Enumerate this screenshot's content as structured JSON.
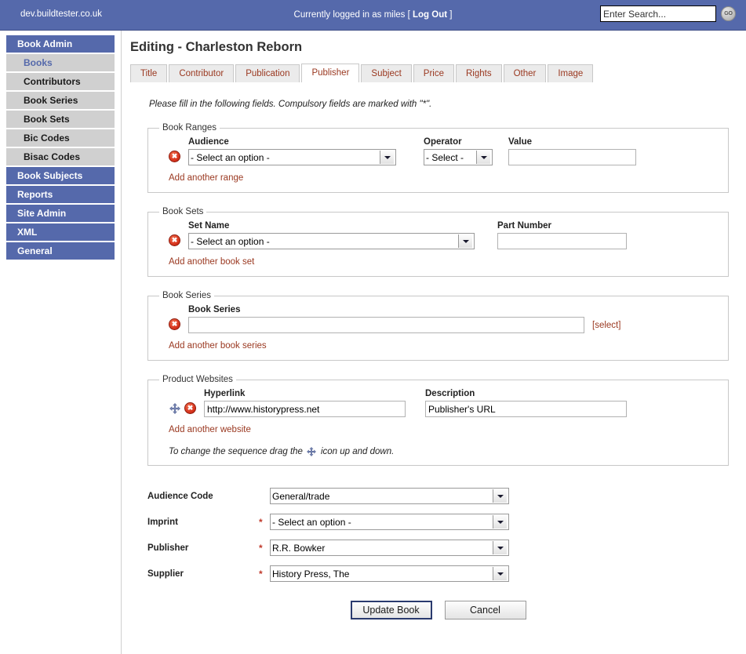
{
  "topbar": {
    "domain": "dev.buildtester.co.uk",
    "login_prefix": "Currently logged in as miles [ ",
    "logout_label": "Log Out",
    "login_suffix": " ]",
    "search_placeholder": "Enter Search...",
    "search_value": "",
    "go_label": "GO",
    "background_color": "#5569ab"
  },
  "sidebar": {
    "items": [
      {
        "label": "Book Admin",
        "type": "header",
        "active": false
      },
      {
        "label": "Books",
        "type": "sub",
        "active": true
      },
      {
        "label": "Contributors",
        "type": "sub",
        "active": false
      },
      {
        "label": "Book Series",
        "type": "sub",
        "active": false
      },
      {
        "label": "Book Sets",
        "type": "sub",
        "active": false
      },
      {
        "label": "Bic Codes",
        "type": "sub",
        "active": false
      },
      {
        "label": "Bisac Codes",
        "type": "sub",
        "active": false
      },
      {
        "label": "Book Subjects",
        "type": "header",
        "active": false
      },
      {
        "label": "Reports",
        "type": "header",
        "active": false
      },
      {
        "label": "Site Admin",
        "type": "header",
        "active": false
      },
      {
        "label": "XML",
        "type": "header",
        "active": false
      },
      {
        "label": "General",
        "type": "header",
        "active": false
      }
    ]
  },
  "main": {
    "page_title": "Editing - Charleston Reborn",
    "tabs": [
      {
        "label": "Title",
        "active": false
      },
      {
        "label": "Contributor",
        "active": false
      },
      {
        "label": "Publication",
        "active": false
      },
      {
        "label": "Publisher",
        "active": true
      },
      {
        "label": "Subject",
        "active": false
      },
      {
        "label": "Price",
        "active": false
      },
      {
        "label": "Rights",
        "active": false
      },
      {
        "label": "Other",
        "active": false
      },
      {
        "label": "Image",
        "active": false
      }
    ],
    "intro_note": "Please fill in the following fields. Compulsory fields are marked with \"*\".",
    "book_ranges": {
      "legend": "Book Ranges",
      "audience_label": "Audience",
      "audience_value": "- Select an option -",
      "operator_label": "Operator",
      "operator_value": "- Select -",
      "value_label": "Value",
      "value_value": "",
      "add_link": "Add another range"
    },
    "book_sets": {
      "legend": "Book Sets",
      "set_name_label": "Set Name",
      "set_name_value": "- Select an option -",
      "part_number_label": "Part Number",
      "part_number_value": "",
      "add_link": "Add another book set"
    },
    "book_series": {
      "legend": "Book Series",
      "field_label": "Book Series",
      "field_value": "",
      "select_link": "[select]",
      "add_link": "Add another book series"
    },
    "product_websites": {
      "legend": "Product Websites",
      "hyperlink_label": "Hyperlink",
      "hyperlink_value": "http://www.historypress.net",
      "description_label": "Description",
      "description_value": "Publisher's URL",
      "add_link": "Add another website",
      "hint_before": "To change the sequence drag the",
      "hint_after": "icon up and down."
    },
    "bottom_fields": [
      {
        "label": "Audience Code",
        "required": "",
        "value": "General/trade"
      },
      {
        "label": "Imprint",
        "required": "*",
        "value": "- Select an option -"
      },
      {
        "label": "Publisher",
        "required": "*",
        "value": "R.R. Bowker"
      },
      {
        "label": "Supplier",
        "required": "*",
        "value": "History Press, The"
      }
    ],
    "buttons": {
      "submit_label": "Update Book",
      "cancel_label": "Cancel"
    }
  }
}
